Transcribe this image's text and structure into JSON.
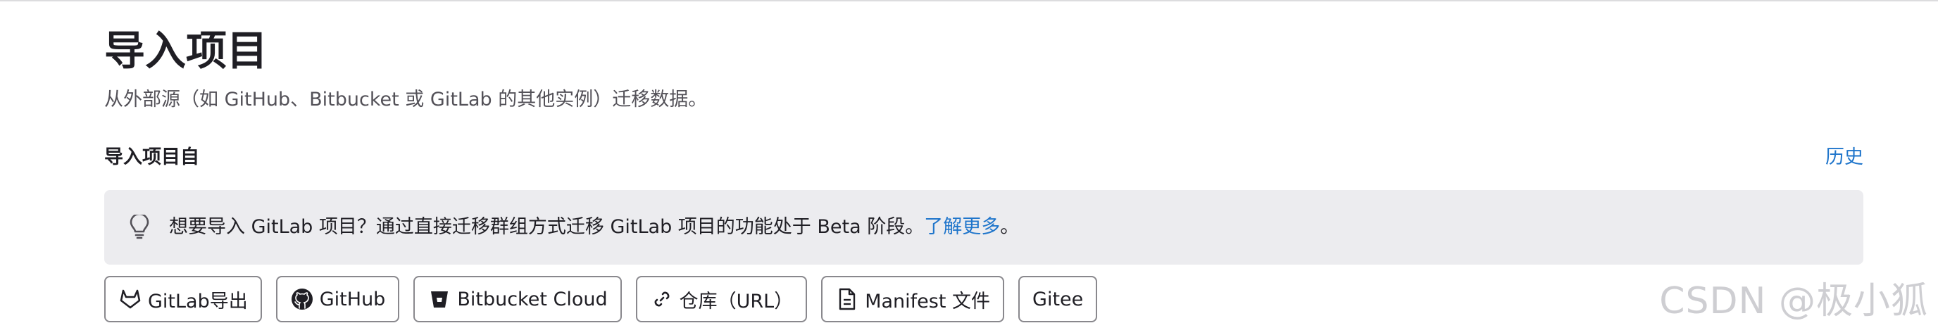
{
  "page": {
    "title": "导入项目",
    "description": "从外部源（如 GitHub、Bitbucket 或 GitLab 的其他实例）迁移数据。"
  },
  "section": {
    "title": "导入项目自",
    "history_link": "历史"
  },
  "alert": {
    "icon": "lightbulb-icon",
    "text": "想要导入 GitLab 项目？通过直接迁移群组方式迁移 GitLab 项目的功能处于 Beta 阶段。",
    "link_text": "了解更多",
    "suffix": "。"
  },
  "import_sources": [
    {
      "label": "GitLab导出",
      "icon": "gitlab-tanuki-icon"
    },
    {
      "label": "GitHub",
      "icon": "github-octocat-icon"
    },
    {
      "label": "Bitbucket Cloud",
      "icon": "bitbucket-icon"
    },
    {
      "label": "仓库（URL）",
      "icon": "link-icon"
    },
    {
      "label": "Manifest 文件",
      "icon": "document-icon"
    },
    {
      "label": "Gitee",
      "icon": ""
    }
  ],
  "watermark": "CSDN @极小狐",
  "colors": {
    "link": "#1f75cb",
    "alert_background": "#ececef",
    "button_border": "#89888d",
    "text": "#1f1e24",
    "muted_text": "#535158"
  }
}
